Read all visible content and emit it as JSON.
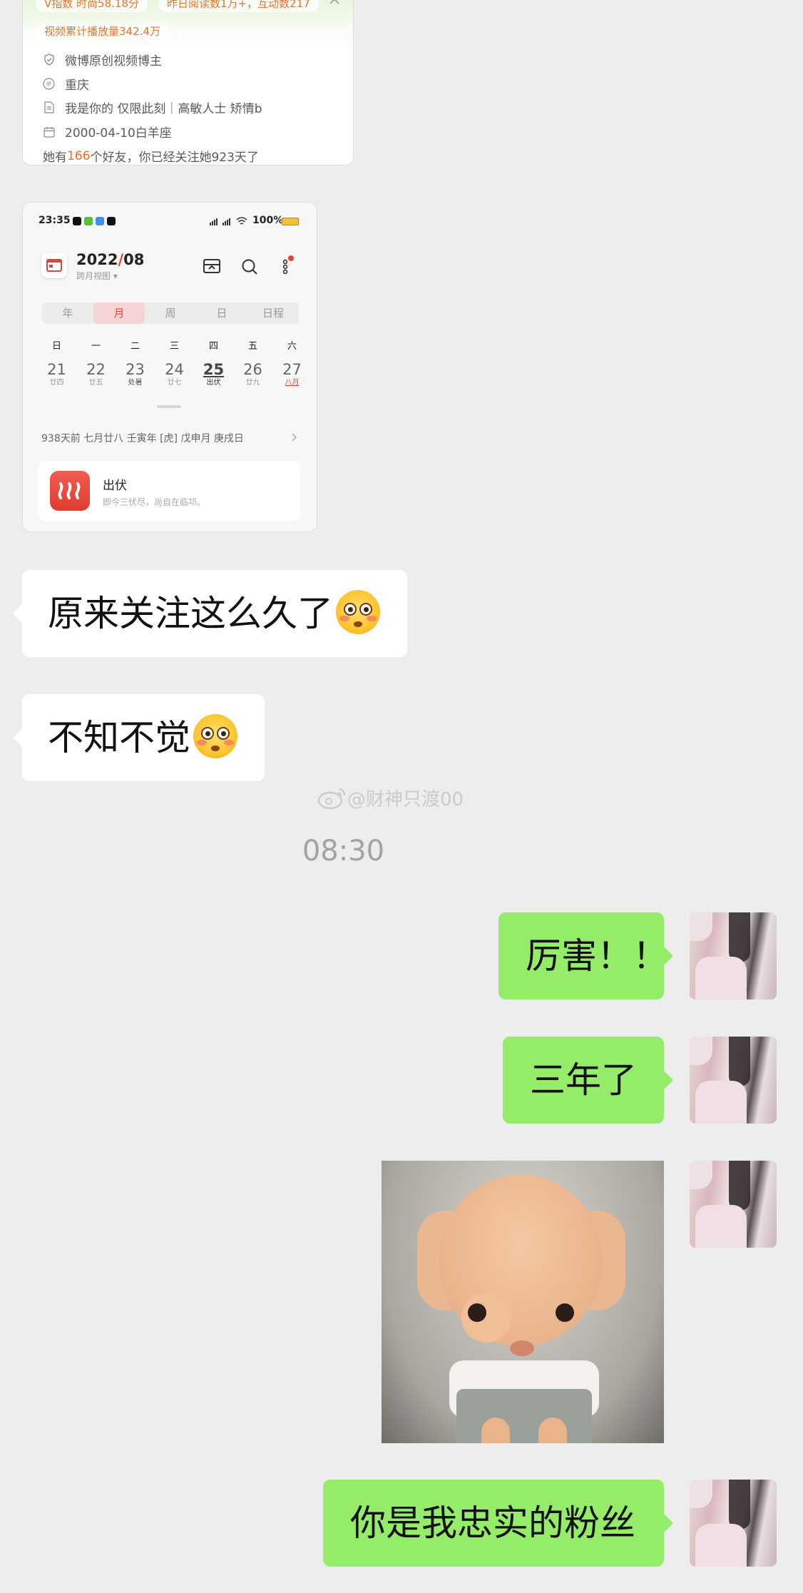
{
  "profile_card": {
    "pill1": "V指数 时尚58.18分",
    "pill2": "昨日阅读数1万+，互动数217",
    "pill3": "视频累计播放量342.4万",
    "verified": "微博原创视频博主",
    "location": "重庆",
    "bio": "我是你的 仅限此刻｜高敏人士 矫情b",
    "birthday": "2000-04-10白羊座",
    "friends_prefix": "她有",
    "friends_count": "166",
    "friends_suffix": "个好友，你已经关注她923天了"
  },
  "calendar_screenshot": {
    "status_time": "23:35",
    "status_battery": "100%",
    "year_month_prefix": "2022",
    "year_month_slash": "/",
    "year_month_suffix": "08",
    "view_label": "跨月视图",
    "segments": [
      "年",
      "月",
      "周",
      "日",
      "日程"
    ],
    "active_segment": "月",
    "weekdays": [
      "日",
      "一",
      "二",
      "三",
      "四",
      "五",
      "六"
    ],
    "days": [
      {
        "num": "21",
        "sub": "廿四"
      },
      {
        "num": "22",
        "sub": "廿五"
      },
      {
        "num": "23",
        "sub": "处暑"
      },
      {
        "num": "24",
        "sub": "廿七"
      },
      {
        "num": "25",
        "sub": "出伏"
      },
      {
        "num": "26",
        "sub": "廿九"
      },
      {
        "num": "27",
        "sub": "八月"
      }
    ],
    "lunar_info": "938天前  七月廿八  壬寅年 [虎] 戊申月 庚戌日",
    "event_title": "出伏",
    "event_desc": "即今三伏尽，尚自在临邛。"
  },
  "messages": {
    "m1": "原来关注这么久了",
    "m2": "不知不觉",
    "watermark": "@财神只渡00",
    "timestamp": "08:30",
    "m3": "厉害！！",
    "m4": "三年了",
    "m5": "你是我忠实的粉丝"
  },
  "colors": {
    "chat_bg": "#ededed",
    "sent_bubble": "#95ec69",
    "received_bubble": "#ffffff",
    "accent_orange": "#ec6f24"
  }
}
